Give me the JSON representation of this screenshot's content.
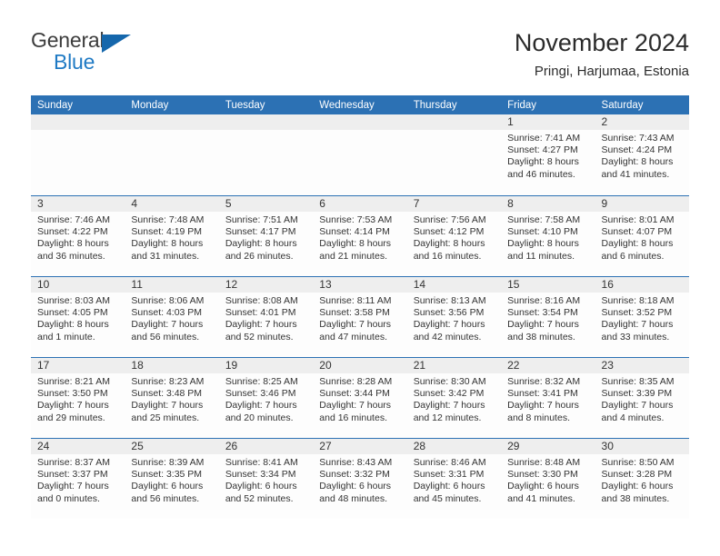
{
  "brand": {
    "name_top": "General",
    "name_bottom": "Blue",
    "color_dark": "#3c3c3c",
    "color_blue": "#1f7ac4"
  },
  "header": {
    "title": "November 2024",
    "subtitle": "Pringi, Harjumaa, Estonia"
  },
  "theme": {
    "header_blue": "#2c71b4",
    "day_strip_gray": "#eeeeee",
    "text": "#333333"
  },
  "weekdays": [
    "Sunday",
    "Monday",
    "Tuesday",
    "Wednesday",
    "Thursday",
    "Friday",
    "Saturday"
  ],
  "labels": {
    "sunrise": "Sunrise:",
    "sunset": "Sunset:",
    "daylight": "Daylight:"
  },
  "weeks": [
    [
      {
        "day": "",
        "empty": true
      },
      {
        "day": "",
        "empty": true
      },
      {
        "day": "",
        "empty": true
      },
      {
        "day": "",
        "empty": true
      },
      {
        "day": "",
        "empty": true
      },
      {
        "day": "1",
        "sunrise": "Sunrise: 7:41 AM",
        "sunset": "Sunset: 4:27 PM",
        "daylight": "Daylight: 8 hours and 46 minutes."
      },
      {
        "day": "2",
        "sunrise": "Sunrise: 7:43 AM",
        "sunset": "Sunset: 4:24 PM",
        "daylight": "Daylight: 8 hours and 41 minutes."
      }
    ],
    [
      {
        "day": "3",
        "sunrise": "Sunrise: 7:46 AM",
        "sunset": "Sunset: 4:22 PM",
        "daylight": "Daylight: 8 hours and 36 minutes."
      },
      {
        "day": "4",
        "sunrise": "Sunrise: 7:48 AM",
        "sunset": "Sunset: 4:19 PM",
        "daylight": "Daylight: 8 hours and 31 minutes."
      },
      {
        "day": "5",
        "sunrise": "Sunrise: 7:51 AM",
        "sunset": "Sunset: 4:17 PM",
        "daylight": "Daylight: 8 hours and 26 minutes."
      },
      {
        "day": "6",
        "sunrise": "Sunrise: 7:53 AM",
        "sunset": "Sunset: 4:14 PM",
        "daylight": "Daylight: 8 hours and 21 minutes."
      },
      {
        "day": "7",
        "sunrise": "Sunrise: 7:56 AM",
        "sunset": "Sunset: 4:12 PM",
        "daylight": "Daylight: 8 hours and 16 minutes."
      },
      {
        "day": "8",
        "sunrise": "Sunrise: 7:58 AM",
        "sunset": "Sunset: 4:10 PM",
        "daylight": "Daylight: 8 hours and 11 minutes."
      },
      {
        "day": "9",
        "sunrise": "Sunrise: 8:01 AM",
        "sunset": "Sunset: 4:07 PM",
        "daylight": "Daylight: 8 hours and 6 minutes."
      }
    ],
    [
      {
        "day": "10",
        "sunrise": "Sunrise: 8:03 AM",
        "sunset": "Sunset: 4:05 PM",
        "daylight": "Daylight: 8 hours and 1 minute."
      },
      {
        "day": "11",
        "sunrise": "Sunrise: 8:06 AM",
        "sunset": "Sunset: 4:03 PM",
        "daylight": "Daylight: 7 hours and 56 minutes."
      },
      {
        "day": "12",
        "sunrise": "Sunrise: 8:08 AM",
        "sunset": "Sunset: 4:01 PM",
        "daylight": "Daylight: 7 hours and 52 minutes."
      },
      {
        "day": "13",
        "sunrise": "Sunrise: 8:11 AM",
        "sunset": "Sunset: 3:58 PM",
        "daylight": "Daylight: 7 hours and 47 minutes."
      },
      {
        "day": "14",
        "sunrise": "Sunrise: 8:13 AM",
        "sunset": "Sunset: 3:56 PM",
        "daylight": "Daylight: 7 hours and 42 minutes."
      },
      {
        "day": "15",
        "sunrise": "Sunrise: 8:16 AM",
        "sunset": "Sunset: 3:54 PM",
        "daylight": "Daylight: 7 hours and 38 minutes."
      },
      {
        "day": "16",
        "sunrise": "Sunrise: 8:18 AM",
        "sunset": "Sunset: 3:52 PM",
        "daylight": "Daylight: 7 hours and 33 minutes."
      }
    ],
    [
      {
        "day": "17",
        "sunrise": "Sunrise: 8:21 AM",
        "sunset": "Sunset: 3:50 PM",
        "daylight": "Daylight: 7 hours and 29 minutes."
      },
      {
        "day": "18",
        "sunrise": "Sunrise: 8:23 AM",
        "sunset": "Sunset: 3:48 PM",
        "daylight": "Daylight: 7 hours and 25 minutes."
      },
      {
        "day": "19",
        "sunrise": "Sunrise: 8:25 AM",
        "sunset": "Sunset: 3:46 PM",
        "daylight": "Daylight: 7 hours and 20 minutes."
      },
      {
        "day": "20",
        "sunrise": "Sunrise: 8:28 AM",
        "sunset": "Sunset: 3:44 PM",
        "daylight": "Daylight: 7 hours and 16 minutes."
      },
      {
        "day": "21",
        "sunrise": "Sunrise: 8:30 AM",
        "sunset": "Sunset: 3:42 PM",
        "daylight": "Daylight: 7 hours and 12 minutes."
      },
      {
        "day": "22",
        "sunrise": "Sunrise: 8:32 AM",
        "sunset": "Sunset: 3:41 PM",
        "daylight": "Daylight: 7 hours and 8 minutes."
      },
      {
        "day": "23",
        "sunrise": "Sunrise: 8:35 AM",
        "sunset": "Sunset: 3:39 PM",
        "daylight": "Daylight: 7 hours and 4 minutes."
      }
    ],
    [
      {
        "day": "24",
        "sunrise": "Sunrise: 8:37 AM",
        "sunset": "Sunset: 3:37 PM",
        "daylight": "Daylight: 7 hours and 0 minutes."
      },
      {
        "day": "25",
        "sunrise": "Sunrise: 8:39 AM",
        "sunset": "Sunset: 3:35 PM",
        "daylight": "Daylight: 6 hours and 56 minutes."
      },
      {
        "day": "26",
        "sunrise": "Sunrise: 8:41 AM",
        "sunset": "Sunset: 3:34 PM",
        "daylight": "Daylight: 6 hours and 52 minutes."
      },
      {
        "day": "27",
        "sunrise": "Sunrise: 8:43 AM",
        "sunset": "Sunset: 3:32 PM",
        "daylight": "Daylight: 6 hours and 48 minutes."
      },
      {
        "day": "28",
        "sunrise": "Sunrise: 8:46 AM",
        "sunset": "Sunset: 3:31 PM",
        "daylight": "Daylight: 6 hours and 45 minutes."
      },
      {
        "day": "29",
        "sunrise": "Sunrise: 8:48 AM",
        "sunset": "Sunset: 3:30 PM",
        "daylight": "Daylight: 6 hours and 41 minutes."
      },
      {
        "day": "30",
        "sunrise": "Sunrise: 8:50 AM",
        "sunset": "Sunset: 3:28 PM",
        "daylight": "Daylight: 6 hours and 38 minutes."
      }
    ]
  ]
}
